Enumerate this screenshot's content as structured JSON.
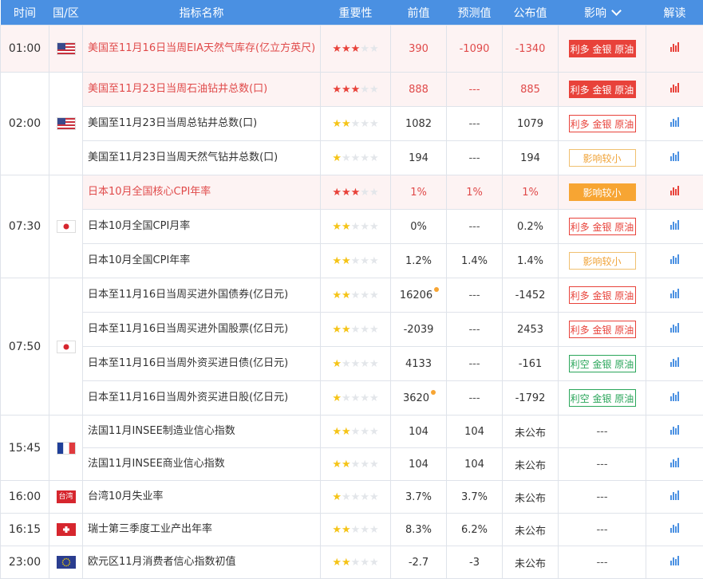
{
  "header": {
    "time": "时间",
    "region": "国/区",
    "name": "指标名称",
    "importance": "重要性",
    "previous": "前值",
    "forecast": "预测值",
    "actual": "公布值",
    "impact": "影响",
    "interpret": "解读"
  },
  "groups": [
    {
      "time": "01:00",
      "flag": "us-flag-icon"
    },
    {
      "time": "02:00",
      "flag": "us-flag-icon"
    },
    {
      "time": "07:30",
      "flag": "japan-flag-icon"
    },
    {
      "time": "07:50",
      "flag": "japan-flag-icon"
    },
    {
      "time": "15:45",
      "flag": "france-flag-icon"
    },
    {
      "time": "16:00",
      "flag": "taiwan-flag-icon",
      "flag_text": "台湾"
    },
    {
      "time": "16:15",
      "flag": "switzerland-flag-icon"
    },
    {
      "time": "23:00",
      "flag": "eu-flag-icon"
    }
  ],
  "rows": [
    {
      "name": "美国至11月16日当周EIA天然气库存(亿立方英尺)",
      "stars": 3,
      "prev": "390",
      "forecast": "-1090",
      "actual": "-1340",
      "impact": "利多 金银 原油"
    },
    {
      "name": "美国至11月23日当周石油钻井总数(口)",
      "stars": 3,
      "prev": "888",
      "forecast": "---",
      "actual": "885",
      "impact": "利多 金银 原油"
    },
    {
      "name": "美国至11月23日当周总钻井总数(口)",
      "stars": 2,
      "prev": "1082",
      "forecast": "---",
      "actual": "1079",
      "impact": "利多 金银 原油"
    },
    {
      "name": "美国至11月23日当周天然气钻井总数(口)",
      "stars": 1,
      "prev": "194",
      "forecast": "---",
      "actual": "194",
      "impact": "影响较小"
    },
    {
      "name": "日本10月全国核心CPI年率",
      "stars": 3,
      "prev": "1%",
      "forecast": "1%",
      "actual": "1%",
      "impact": "影响较小"
    },
    {
      "name": "日本10月全国CPI月率",
      "stars": 2,
      "prev": "0%",
      "forecast": "---",
      "actual": "0.2%",
      "impact": "利多 金银 原油"
    },
    {
      "name": "日本10月全国CPI年率",
      "stars": 2,
      "prev": "1.2%",
      "forecast": "1.4%",
      "actual": "1.4%",
      "impact": "影响较小"
    },
    {
      "name": "日本至11月16日当周买进外国债券(亿日元)",
      "stars": 2,
      "prev": "16206",
      "forecast": "---",
      "actual": "-1452",
      "impact": "利多 金银 原油"
    },
    {
      "name": "日本至11月16日当周买进外国股票(亿日元)",
      "stars": 2,
      "prev": "-2039",
      "forecast": "---",
      "actual": "2453",
      "impact": "利多 金银 原油"
    },
    {
      "name": "日本至11月16日当周外资买进日债(亿日元)",
      "stars": 1,
      "prev": "4133",
      "forecast": "---",
      "actual": "-161",
      "impact": "利空 金银 原油"
    },
    {
      "name": "日本至11月16日当周外资买进日股(亿日元)",
      "stars": 1,
      "prev": "3620",
      "forecast": "---",
      "actual": "-1792",
      "impact": "利空 金银 原油"
    },
    {
      "name": "法国11月INSEE制造业信心指数",
      "stars": 2,
      "prev": "104",
      "forecast": "104",
      "actual": "未公布",
      "impact": "---"
    },
    {
      "name": "法国11月INSEE商业信心指数",
      "stars": 2,
      "prev": "104",
      "forecast": "104",
      "actual": "未公布",
      "impact": "---"
    },
    {
      "name": "台湾10月失业率",
      "stars": 1,
      "prev": "3.7%",
      "forecast": "3.7%",
      "actual": "未公布",
      "impact": "---"
    },
    {
      "name": "瑞士第三季度工业产出年率",
      "stars": 2,
      "prev": "8.3%",
      "forecast": "6.2%",
      "actual": "未公布",
      "impact": "---"
    },
    {
      "name": "欧元区11月消费者信心指数初值",
      "stars": 2,
      "prev": "-2.7",
      "forecast": "-3",
      "actual": "未公布",
      "impact": "---"
    }
  ],
  "colors": {
    "header": "#4a90e2",
    "highlight": "#fdf3f3",
    "red": "#e8423a",
    "green": "#2aa65a",
    "orange": "#f7a533"
  }
}
